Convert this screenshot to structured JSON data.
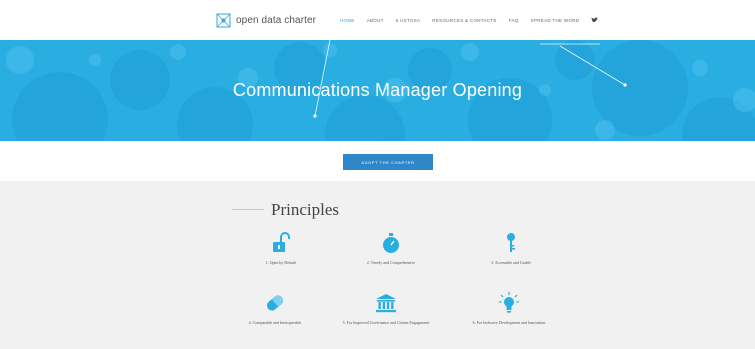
{
  "header": {
    "logo_text": "open data charter",
    "nav": [
      {
        "label": "Home",
        "active": true
      },
      {
        "label": "About",
        "active": false
      },
      {
        "label": "6 Ustosa",
        "active": false
      },
      {
        "label": "Resources & Contacts",
        "active": false
      },
      {
        "label": "FAQ",
        "active": false
      },
      {
        "label": "Spread the Word",
        "active": false
      }
    ],
    "social_icon": "twitter-bird-icon"
  },
  "hero": {
    "title": "Communications Manager Opening",
    "background_color": "#2aaee2"
  },
  "cta": {
    "label": "Adopt the Charter",
    "color": "#2f86c9"
  },
  "principles": {
    "title": "Principles",
    "items": [
      {
        "label": "1. Open by Default",
        "icon": "unlocked-padlock-icon"
      },
      {
        "label": "2. Timely and Comprehensive",
        "icon": "stopwatch-icon"
      },
      {
        "label": "3. Accessible and Usable",
        "icon": "key-icon"
      },
      {
        "label": "4. Comparable and Interoperable",
        "icon": "capsule-icon"
      },
      {
        "label": "5. For Improved Governance and Citizen Engagement",
        "icon": "government-building-icon"
      },
      {
        "label": "6. For Inclusive Development and Innovation",
        "icon": "light-bulb-icon"
      }
    ]
  }
}
